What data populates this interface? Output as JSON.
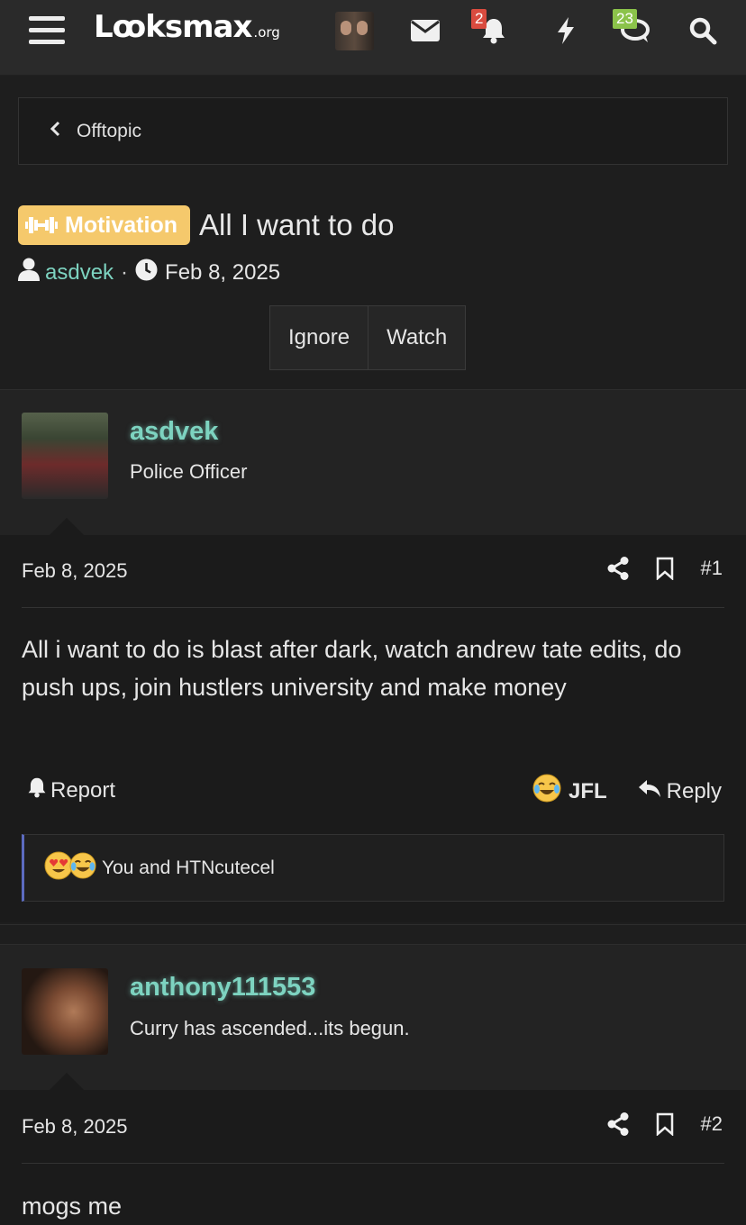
{
  "header": {
    "logo_main": "Lꝏksmax",
    "logo_tld": ".org",
    "notification_count": "2",
    "conversation_count": "23",
    "colors": {
      "notification_badge": "#d94b3f",
      "conversation_badge": "#8bc34a"
    }
  },
  "breadcrumb": {
    "label": "Offtopic"
  },
  "thread": {
    "prefix": "Motivation",
    "title": "All I want to do",
    "author": "asdvek",
    "meta_separator": "·",
    "date": "Feb 8, 2025",
    "buttons": {
      "ignore": "Ignore",
      "watch": "Watch"
    }
  },
  "posts": [
    {
      "username": "asdvek",
      "user_title": "Police Officer",
      "date": "Feb 8, 2025",
      "number": "#1",
      "message": "All i want to do is blast after dark, watch andrew tate edits, do push ups, join hustlers university and make money",
      "report_label": "Report",
      "reaction_label": "JFL",
      "reply_label": "Reply",
      "reactions_summary": "You and HTNcutecel"
    },
    {
      "username": "anthony111553",
      "user_title": "Curry has ascended...its begun.",
      "date": "Feb 8, 2025",
      "number": "#2",
      "message": "mogs me"
    }
  ]
}
